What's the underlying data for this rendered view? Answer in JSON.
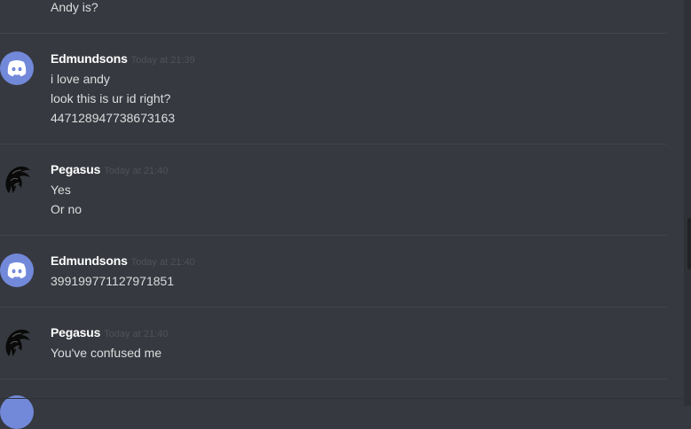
{
  "messages": {
    "partial_top": {
      "lines": [
        "Andy is?"
      ]
    },
    "group1": {
      "username": "Edmundsons",
      "timestamp": "Today at 21:39",
      "avatar_icon": "discord-logo-icon",
      "lines": [
        "i love andy",
        "look this is ur id right?",
        "447128947738673163"
      ]
    },
    "group2": {
      "username": "Pegasus",
      "timestamp": "Today at 21:40",
      "avatar_icon": "pegasus-avatar-icon",
      "lines": [
        "Yes",
        "Or no"
      ]
    },
    "group3": {
      "username": "Edmundsons",
      "timestamp": "Today at 21:40",
      "avatar_icon": "discord-logo-icon",
      "lines": [
        "399199771127971851"
      ]
    },
    "group4": {
      "username": "Pegasus",
      "timestamp": "Today at 21:40",
      "avatar_icon": "pegasus-avatar-icon",
      "lines": [
        "You've confused me"
      ]
    }
  },
  "colors": {
    "background": "#36393f",
    "username": "#ffffff",
    "text": "#dcddde",
    "timestamp": "#4f5359",
    "discord_blurple": "#7289da"
  }
}
